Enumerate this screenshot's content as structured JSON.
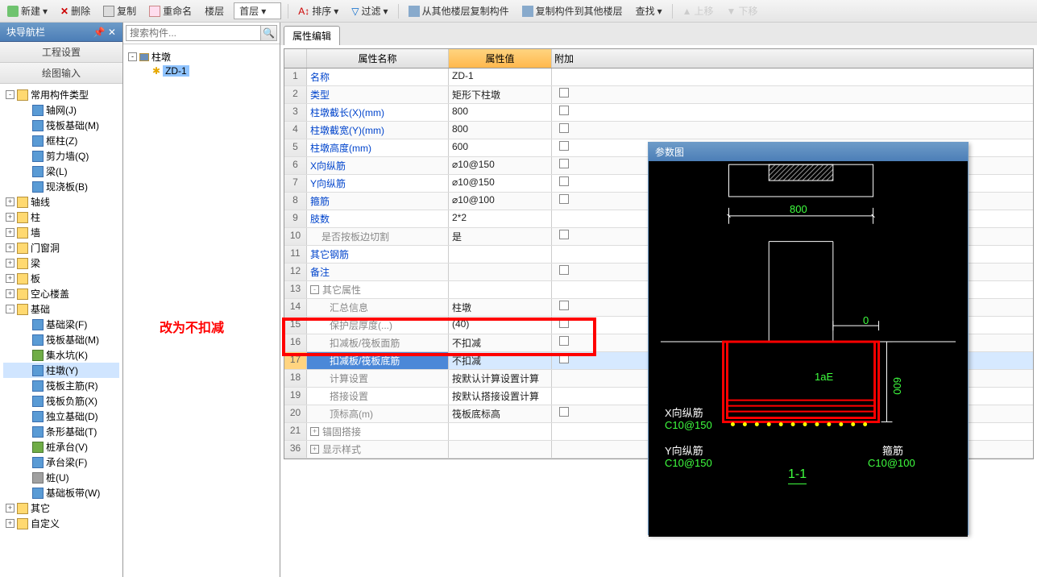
{
  "toolbar": {
    "new": "新建",
    "delete": "删除",
    "copy": "复制",
    "rename": "重命名",
    "floor": "楼层",
    "first_floor": "首层",
    "sort": "排序",
    "filter": "过滤",
    "copy_from_floor": "从其他楼层复制构件",
    "copy_to_floor": "复制构件到其他楼层",
    "find": "查找",
    "move_up": "上移",
    "move_down": "下移"
  },
  "nav": {
    "title": "块导航栏",
    "menu1": "工程设置",
    "menu2": "绘图输入",
    "items": [
      {
        "label": "常用构件类型",
        "type": "folder",
        "expanded": true,
        "level": 0
      },
      {
        "label": "轴网(J)",
        "type": "blue",
        "level": 1
      },
      {
        "label": "筏板基础(M)",
        "type": "blue",
        "level": 1
      },
      {
        "label": "框柱(Z)",
        "type": "blue",
        "level": 1
      },
      {
        "label": "剪力墙(Q)",
        "type": "blue",
        "level": 1
      },
      {
        "label": "梁(L)",
        "type": "blue",
        "level": 1
      },
      {
        "label": "现浇板(B)",
        "type": "blue",
        "level": 1
      },
      {
        "label": "轴线",
        "type": "folder",
        "level": 0
      },
      {
        "label": "柱",
        "type": "folder",
        "level": 0
      },
      {
        "label": "墙",
        "type": "folder",
        "level": 0
      },
      {
        "label": "门窗洞",
        "type": "folder",
        "level": 0
      },
      {
        "label": "梁",
        "type": "folder",
        "level": 0
      },
      {
        "label": "板",
        "type": "folder",
        "level": 0
      },
      {
        "label": "空心楼盖",
        "type": "folder",
        "level": 0
      },
      {
        "label": "基础",
        "type": "folder",
        "expanded": true,
        "level": 0
      },
      {
        "label": "基础梁(F)",
        "type": "blue",
        "level": 1
      },
      {
        "label": "筏板基础(M)",
        "type": "blue",
        "level": 1
      },
      {
        "label": "集水坑(K)",
        "type": "green",
        "level": 1
      },
      {
        "label": "柱墩(Y)",
        "type": "blue",
        "level": 1,
        "selected": true
      },
      {
        "label": "筏板主筋(R)",
        "type": "blue",
        "level": 1
      },
      {
        "label": "筏板负筋(X)",
        "type": "blue",
        "level": 1
      },
      {
        "label": "独立基础(D)",
        "type": "blue",
        "level": 1
      },
      {
        "label": "条形基础(T)",
        "type": "blue",
        "level": 1
      },
      {
        "label": "桩承台(V)",
        "type": "green",
        "level": 1
      },
      {
        "label": "承台梁(F)",
        "type": "blue",
        "level": 1
      },
      {
        "label": "桩(U)",
        "type": "gray",
        "level": 1
      },
      {
        "label": "基础板带(W)",
        "type": "blue",
        "level": 1
      },
      {
        "label": "其它",
        "type": "folder",
        "level": 0
      },
      {
        "label": "自定义",
        "type": "folder",
        "level": 0
      }
    ]
  },
  "search": {
    "placeholder": "搜索构件..."
  },
  "comp_tree": {
    "root": "柱墩",
    "item": "ZD-1"
  },
  "red_annotation": "改为不扣减",
  "prop": {
    "tab": "属性编辑",
    "header_name": "属性名称",
    "header_value": "属性值",
    "header_extra": "附加",
    "rows": [
      {
        "num": "1",
        "name": "名称",
        "value": "ZD-1",
        "chk": false
      },
      {
        "num": "2",
        "name": "类型",
        "value": "矩形下柱墩",
        "chk": true
      },
      {
        "num": "3",
        "name": "柱墩截长(X)(mm)",
        "value": "800",
        "chk": true
      },
      {
        "num": "4",
        "name": "柱墩截宽(Y)(mm)",
        "value": "800",
        "chk": true
      },
      {
        "num": "5",
        "name": "柱墩高度(mm)",
        "value": "600",
        "chk": true
      },
      {
        "num": "6",
        "name": "X向纵筋",
        "value": "⌀10@150",
        "chk": true
      },
      {
        "num": "7",
        "name": "Y向纵筋",
        "value": "⌀10@150",
        "chk": true
      },
      {
        "num": "8",
        "name": "箍筋",
        "value": "⌀10@100",
        "chk": true
      },
      {
        "num": "9",
        "name": "肢数",
        "value": "2*2",
        "chk": false
      },
      {
        "num": "10",
        "name": "是否按板边切割",
        "value": "是",
        "chk": true,
        "gray": true,
        "indent": true
      },
      {
        "num": "11",
        "name": "其它钢筋",
        "value": "",
        "chk": false
      },
      {
        "num": "12",
        "name": "备注",
        "value": "",
        "chk": true
      },
      {
        "num": "13",
        "name": "其它属性",
        "value": "",
        "group": true,
        "exp": "-"
      },
      {
        "num": "14",
        "name": "汇总信息",
        "value": "柱墩",
        "chk": true,
        "gray": true,
        "indent2": true
      },
      {
        "num": "15",
        "name": "保护层厚度(...)",
        "value": "(40)",
        "chk": true,
        "gray": true,
        "indent2": true
      },
      {
        "num": "16",
        "name": "扣减板/筏板面筋",
        "value": "不扣减",
        "chk": true,
        "gray": true,
        "indent2": true
      },
      {
        "num": "17",
        "name": "扣减板/筏板底筋",
        "value": "不扣减",
        "chk": true,
        "gray": true,
        "indent2": true,
        "selected": true
      },
      {
        "num": "18",
        "name": "计算设置",
        "value": "按默认计算设置计算",
        "chk": false,
        "gray": true,
        "indent2": true
      },
      {
        "num": "19",
        "name": "搭接设置",
        "value": "按默认搭接设置计算",
        "chk": false,
        "gray": true,
        "indent2": true
      },
      {
        "num": "20",
        "name": "顶标高(m)",
        "value": "筏板底标高",
        "chk": true,
        "gray": true,
        "indent2": true
      },
      {
        "num": "21",
        "name": "锚固搭接",
        "value": "",
        "group": true,
        "exp": "+"
      },
      {
        "num": "36",
        "name": "显示样式",
        "value": "",
        "group": true,
        "exp": "+"
      }
    ]
  },
  "diagram": {
    "title": "参数图",
    "dim_800": "800",
    "dim_0": "0",
    "dim_600": "600",
    "label_1aE": "1aE",
    "label_x": "X向纵筋",
    "label_x_val": "C10@150",
    "label_y": "Y向纵筋",
    "label_y_val": "C10@150",
    "label_gu": "箍筋",
    "label_gu_val": "C10@100",
    "section": "1-1"
  }
}
